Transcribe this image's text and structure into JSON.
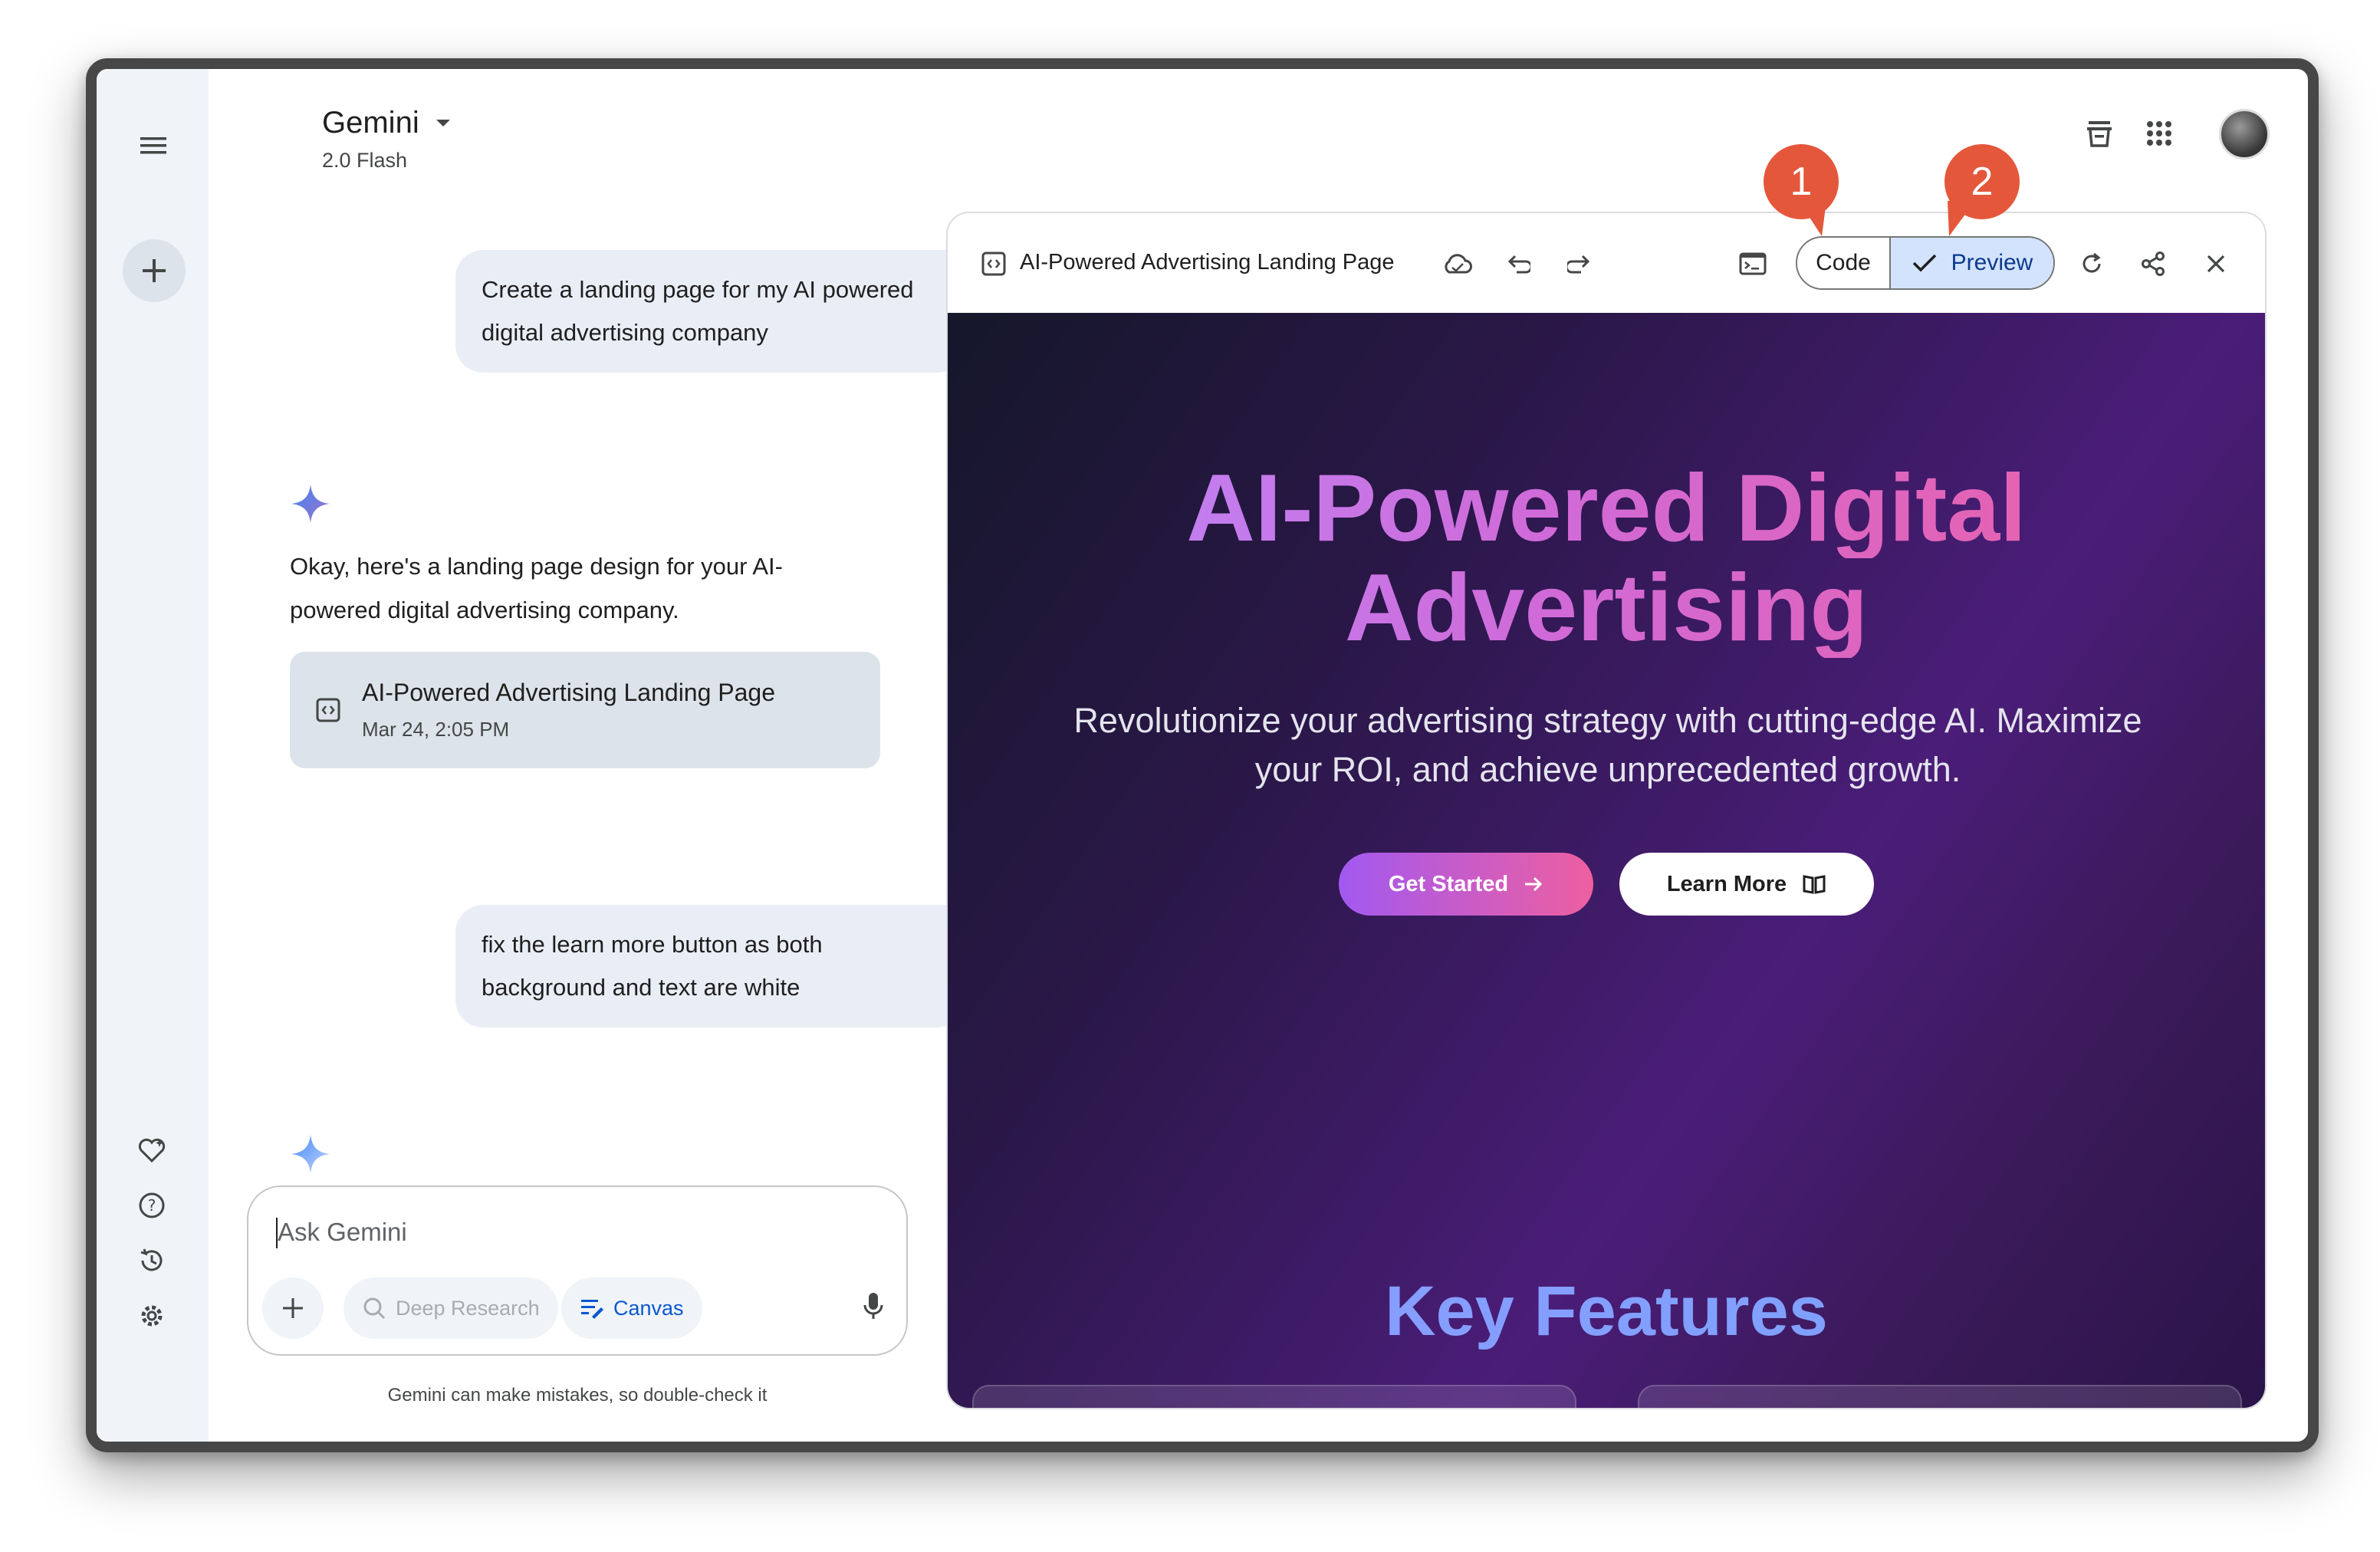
{
  "header": {
    "app_name": "Gemini",
    "model": "2.0 Flash"
  },
  "conversation": {
    "user_msg_1": [
      "Create a landing page for my AI powered",
      "digital advertising company"
    ],
    "assistant_reply": [
      "Okay, here's a landing page design for your AI-",
      "powered digital advertising company."
    ],
    "doc_card": {
      "title": "AI-Powered Advertising Landing Page",
      "date": "Mar 24, 2:05 PM"
    },
    "user_msg_2": [
      "fix the learn more button as both",
      "background and text are white"
    ]
  },
  "input": {
    "placeholder": "Ask Gemini",
    "deep_research_label": "Deep Research",
    "canvas_label": "Canvas",
    "disclaimer": "Gemini can make mistakes, so double-check it"
  },
  "canvas": {
    "title": "AI-Powered Advertising Landing Page",
    "code_label": "Code",
    "preview_label": "Preview",
    "selected_view": "Preview"
  },
  "preview_page": {
    "hero_title_line1": "AI-Powered Digital",
    "hero_title_line2": "Advertising",
    "hero_subtitle_line1": "Revolutionize your advertising strategy with cutting-edge AI. Maximize",
    "hero_subtitle_line2": "your ROI, and achieve unprecedented growth.",
    "get_started_label": "Get Started",
    "learn_more_label": "Learn More",
    "features_title": "Key Features"
  },
  "annotations": {
    "callout_1": "1",
    "callout_2": "2"
  },
  "colors": {
    "accent_blue": "#0b57d0",
    "callout": "#e4573b",
    "preview_bg": "#4a1d78"
  },
  "icons": [
    "menu-icon",
    "plus-icon",
    "gem-icon",
    "help-icon",
    "history-icon",
    "settings-icon",
    "trash-icon",
    "apps-icon",
    "sparkle-icon",
    "code-doc-icon",
    "cloud-icon",
    "undo-icon",
    "redo-icon",
    "terminal-icon",
    "check-icon",
    "refresh-icon",
    "share-icon",
    "close-icon",
    "mic-icon",
    "arrow-right-icon",
    "book-icon"
  ]
}
